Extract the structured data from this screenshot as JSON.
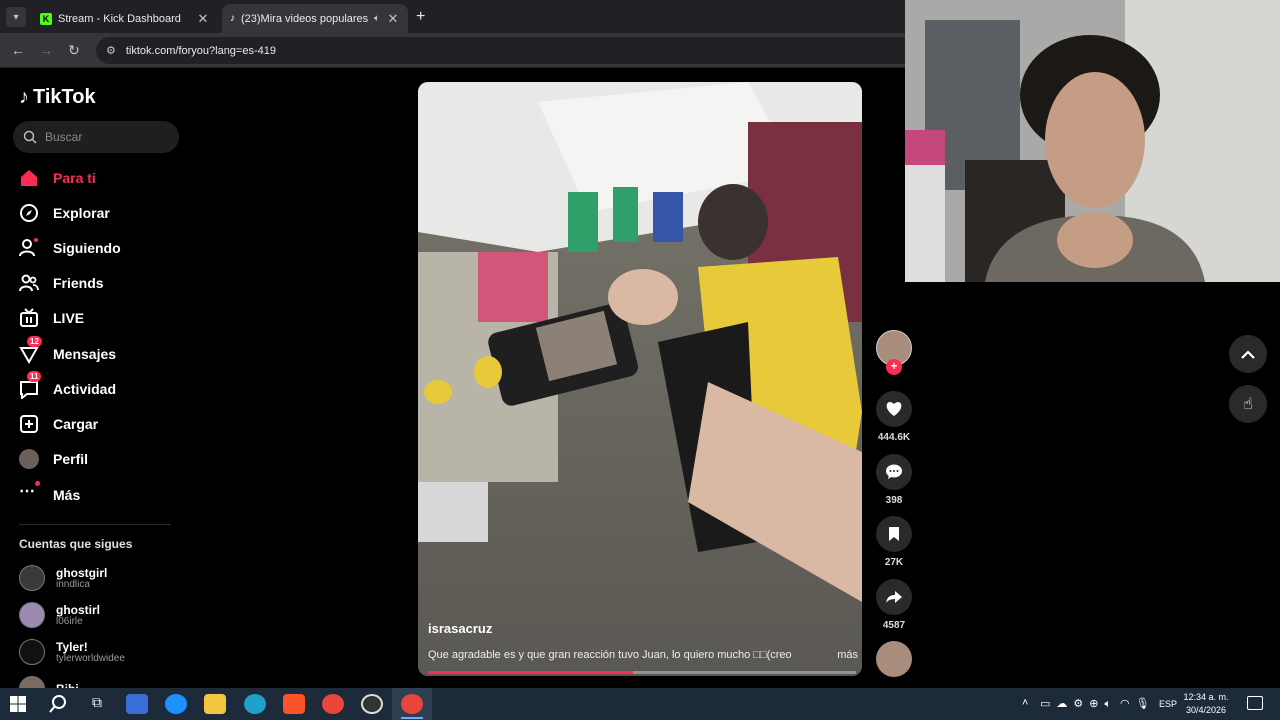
{
  "browser": {
    "tabs": [
      {
        "title": "Stream - Kick Dashboard",
        "active": false
      },
      {
        "title": "(23)Mira videos populares",
        "active": true
      }
    ],
    "url": "tiktok.com/foryou?lang=es-419"
  },
  "tiktok": {
    "logo": "TikTok",
    "search_placeholder": "Buscar",
    "nav": [
      {
        "label": "Para ti",
        "icon": "home-icon",
        "active": true
      },
      {
        "label": "Explorar",
        "icon": "compass-icon"
      },
      {
        "label": "Siguiendo",
        "icon": "following-icon"
      },
      {
        "label": "Friends",
        "icon": "friends-icon"
      },
      {
        "label": "LIVE",
        "icon": "live-icon"
      },
      {
        "label": "Mensajes",
        "icon": "messages-icon",
        "badge": "12"
      },
      {
        "label": "Actividad",
        "icon": "activity-icon",
        "badge": "11"
      },
      {
        "label": "Cargar",
        "icon": "upload-icon"
      },
      {
        "label": "Perfil",
        "icon": "avatar"
      },
      {
        "label": "Más",
        "icon": "more-icon"
      }
    ],
    "following_header": "Cuentas que sigues",
    "accounts": [
      {
        "name": "ghostgirl",
        "username": "inndlica"
      },
      {
        "name": "ghostirl",
        "username": "l06irle"
      },
      {
        "name": "Tyler!",
        "username": "tylerworldwidee"
      },
      {
        "name": "Bibi",
        "username": ""
      }
    ],
    "video": {
      "author": "israsacruz",
      "caption": "Que agradable es y que gran reacción tuvo Juan, lo quiero mucho □□(creo",
      "more": "más",
      "progress": 0.48
    },
    "actions": {
      "likes": "444.6K",
      "comments": "398",
      "saves": "27K",
      "shares": "4587"
    }
  },
  "taskbar": {
    "time": "12:34 a. m.",
    "date": "30/4/2026",
    "lang": "ESP"
  },
  "colors": {
    "accent": "#fe2c55"
  }
}
